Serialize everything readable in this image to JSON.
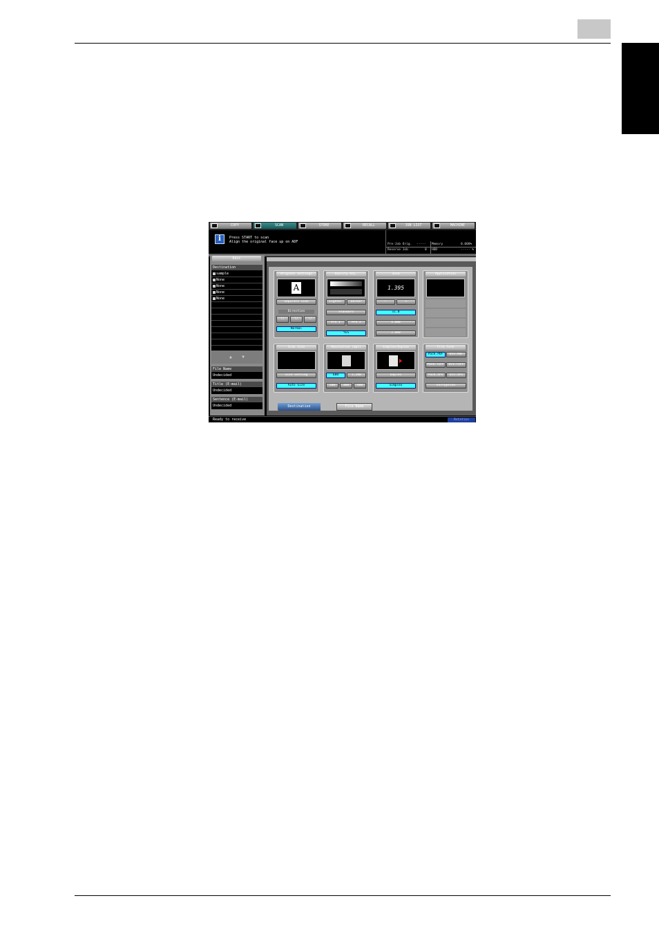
{
  "tabs": [
    {
      "label": "COPY"
    },
    {
      "label": "SCAN"
    },
    {
      "label": "STORE"
    },
    {
      "label": "RECALL"
    },
    {
      "label": "JOB LIST"
    },
    {
      "label": "MACHINE"
    }
  ],
  "message": {
    "line1": "Press START to scan",
    "line2": "Align the original face up on ADF"
  },
  "status": {
    "prejob_label": "Pre-Job Orig.",
    "prejob_value": "-----",
    "reserve_label": "Reserve Job",
    "reserve_value": "0",
    "memory_label": "Memory",
    "memory_value": "0.000%",
    "hdd_label": "HDD",
    "hdd_value": "----- %"
  },
  "left": {
    "edit_label": "Edit",
    "destination_header": "Destination",
    "destinations": [
      {
        "name": "sample"
      },
      {
        "name": "None"
      },
      {
        "name": "None"
      },
      {
        "name": "None"
      },
      {
        "name": "None"
      }
    ],
    "up_arrow": "▲",
    "down_arrow": "▼",
    "file_name_label": "File Name",
    "file_name_value": "Undecided",
    "title_label": "Title (E-mail)",
    "title_value": "Undecided",
    "sentence_label": "Sentence (E-mail)",
    "sentence_value": "Undecided"
  },
  "original_settings": {
    "title": "Original Settings",
    "glyph": "A",
    "separate_scan": "Separate Scan",
    "direction_label": "Direction",
    "normal": "Normal"
  },
  "quality_adj": {
    "title": "Quality Adj.",
    "lighter": "Lighter",
    "darker": "Darker",
    "standard": "Standard",
    "pre1": "Pre 1",
    "pre2": "Pre 2",
    "yes": "YES"
  },
  "zoom": {
    "title": "Zoom",
    "value": "1.395",
    "minus": "−",
    "plus": "+",
    "x1": "x1.0",
    "x2": "4.000",
    "x3": "2.000"
  },
  "application": {
    "title": "Application"
  },
  "scan_size": {
    "title": "Scan Size",
    "size_setting": "Size Setting",
    "auto_size": "Auto Size"
  },
  "resolution": {
    "title": "Resolution (dpi)",
    "r600": "600",
    "r1200": "1,200",
    "r200": "200",
    "r300": "300",
    "r400": "400"
  },
  "simplex_duplex": {
    "title": "Simplex/Duplex",
    "duplex": "Duplex",
    "simplex": "Simplex"
  },
  "file_form": {
    "title": "File Form",
    "pack_pdf": "Pack.PDF",
    "div_pdf": "Div.PDF",
    "pack_tiff": "Pack.TIFF",
    "div_tiff": "Div.TIFF",
    "pack_xps": "Pack.XPS",
    "div_xps": "Div.XPS",
    "encryption": "Encryption"
  },
  "bottom": {
    "destination_button": "Destination",
    "file_name_button": "File Name"
  },
  "statusbar": {
    "text": "Ready to receive",
    "rotation": "Rotation"
  },
  "colors": {
    "accent": "#40ffff",
    "tab_active": "#2a7070",
    "destination_button": "#3b67a8"
  }
}
